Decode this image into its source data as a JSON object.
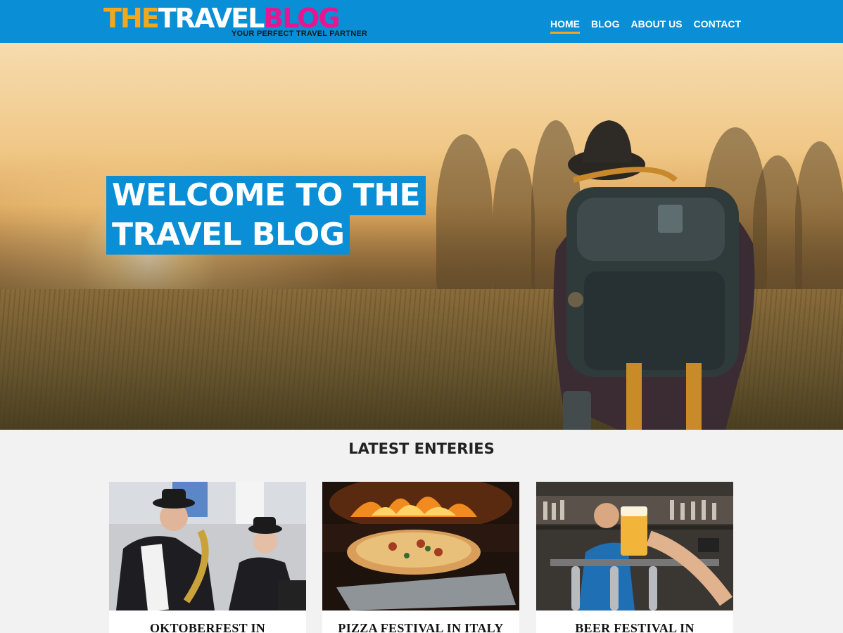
{
  "header": {
    "logo": {
      "the": "THE",
      "travel": "TRAVEL",
      "blog": "BLOG",
      "tagline": "YOUR PERFECT TRAVEL PARTNER"
    },
    "nav": [
      {
        "label": "HOME",
        "active": true
      },
      {
        "label": "BLOG",
        "active": false
      },
      {
        "label": "ABOUT US",
        "active": false
      },
      {
        "label": "CONTACT",
        "active": false
      }
    ]
  },
  "hero": {
    "title_line1": "WELCOME TO THE",
    "title_line2": "TRAVEL BLOG"
  },
  "latest": {
    "title": "LATEST ENTERIES",
    "cards": [
      {
        "title": "OKTOBERFEST IN"
      },
      {
        "title": "PIZZA FESTIVAL IN ITALY"
      },
      {
        "title": "BEER FESTIVAL IN"
      }
    ]
  },
  "colors": {
    "brand_blue": "#0a8fd6",
    "accent_orange": "#f2a81d",
    "accent_pink": "#e5168f"
  }
}
